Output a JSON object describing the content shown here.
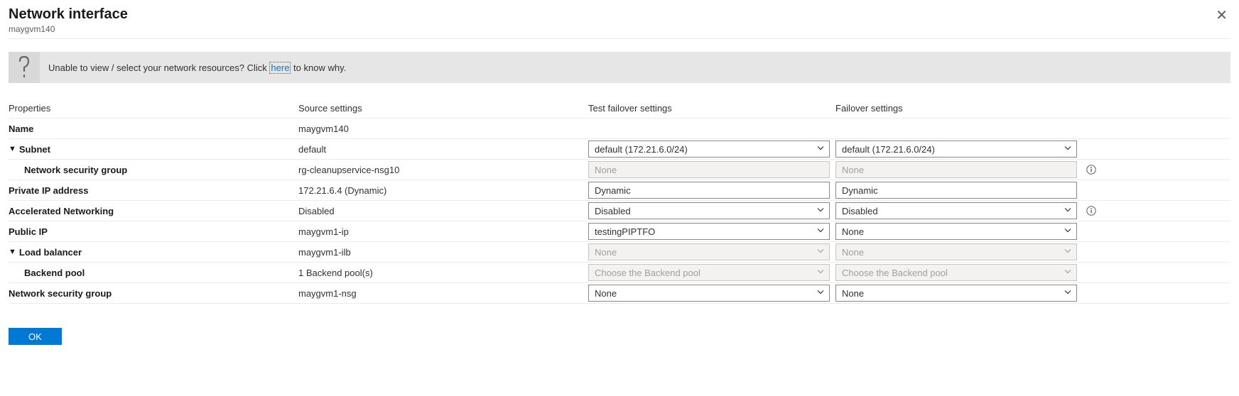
{
  "header": {
    "title": "Network interface",
    "subtitle": "maygvm140",
    "close": "✕"
  },
  "infoBar": {
    "prefix": "Unable to view / select your network resources? Click ",
    "link": "here",
    "suffix": " to know why."
  },
  "columns": {
    "properties": "Properties",
    "source": "Source settings",
    "tfo": "Test failover settings",
    "fo": "Failover settings"
  },
  "rows": {
    "name": {
      "label": "Name",
      "source": "maygvm140"
    },
    "subnet": {
      "label": "Subnet",
      "source": "default",
      "tfo": "default (172.21.6.0/24)",
      "fo": "default (172.21.6.0/24)"
    },
    "nsgSub": {
      "label": "Network security group",
      "source": "rg-cleanupservice-nsg10",
      "tfo": "None",
      "fo": "None"
    },
    "pip": {
      "label": "Private IP address",
      "source": "172.21.6.4 (Dynamic)",
      "tfo": "Dynamic",
      "fo": "Dynamic"
    },
    "accel": {
      "label": "Accelerated Networking",
      "source": "Disabled",
      "tfo": "Disabled",
      "fo": "Disabled"
    },
    "pubip": {
      "label": "Public IP",
      "source": "maygvm1-ip",
      "tfo": "testingPIPTFO",
      "fo": "None"
    },
    "lb": {
      "label": "Load balancer",
      "source": "maygvm1-ilb",
      "tfo": "None",
      "fo": "None"
    },
    "bepool": {
      "label": "Backend pool",
      "source": "1 Backend pool(s)",
      "tfo": "Choose the Backend pool",
      "fo": "Choose the Backend pool"
    },
    "nsg": {
      "label": "Network security group",
      "source": "maygvm1-nsg",
      "tfo": "None",
      "fo": "None"
    }
  },
  "buttons": {
    "ok": "OK"
  }
}
